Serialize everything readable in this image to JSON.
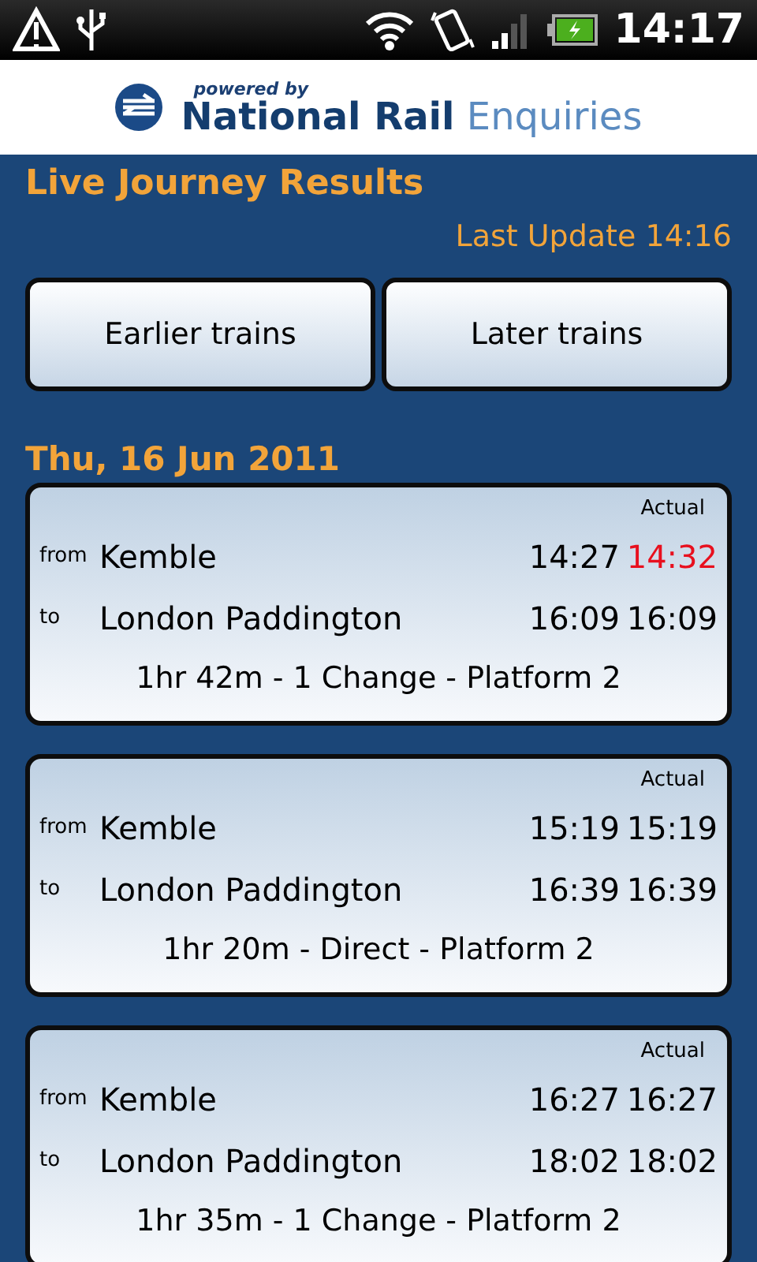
{
  "status_bar": {
    "time": "14:17"
  },
  "header": {
    "logo_small": "powered by",
    "logo_main": "National Rail",
    "logo_light": "Enquiries"
  },
  "title": "Live Journey Results",
  "last_update": "Last Update 14:16",
  "buttons": [
    "Earlier trains",
    "Later trains"
  ],
  "date": "Thu, 16 Jun 2011",
  "journeys": [
    {
      "actual_label": "Actual",
      "from_label": "from",
      "from": "Kemble",
      "dep": "14:27",
      "dep_actual": "14:32",
      "dep_late": true,
      "to_label": "to",
      "to": "London Paddington",
      "arr": "16:09",
      "arr_actual": "16:09",
      "arr_late": false,
      "summary": "1hr 42m - 1 Change - Platform 2"
    },
    {
      "actual_label": "Actual",
      "from_label": "from",
      "from": "Kemble",
      "dep": "15:19",
      "dep_actual": "15:19",
      "dep_late": false,
      "to_label": "to",
      "to": "London Paddington",
      "arr": "16:39",
      "arr_actual": "16:39",
      "arr_late": false,
      "summary": "1hr 20m - Direct - Platform 2"
    },
    {
      "actual_label": "Actual",
      "from_label": "from",
      "from": "Kemble",
      "dep": "16:27",
      "dep_actual": "16:27",
      "dep_late": false,
      "to_label": "to",
      "to": "London Paddington",
      "arr": "18:02",
      "arr_actual": "18:02",
      "arr_late": false,
      "summary": "1hr 35m - 1 Change - Platform 2"
    }
  ]
}
